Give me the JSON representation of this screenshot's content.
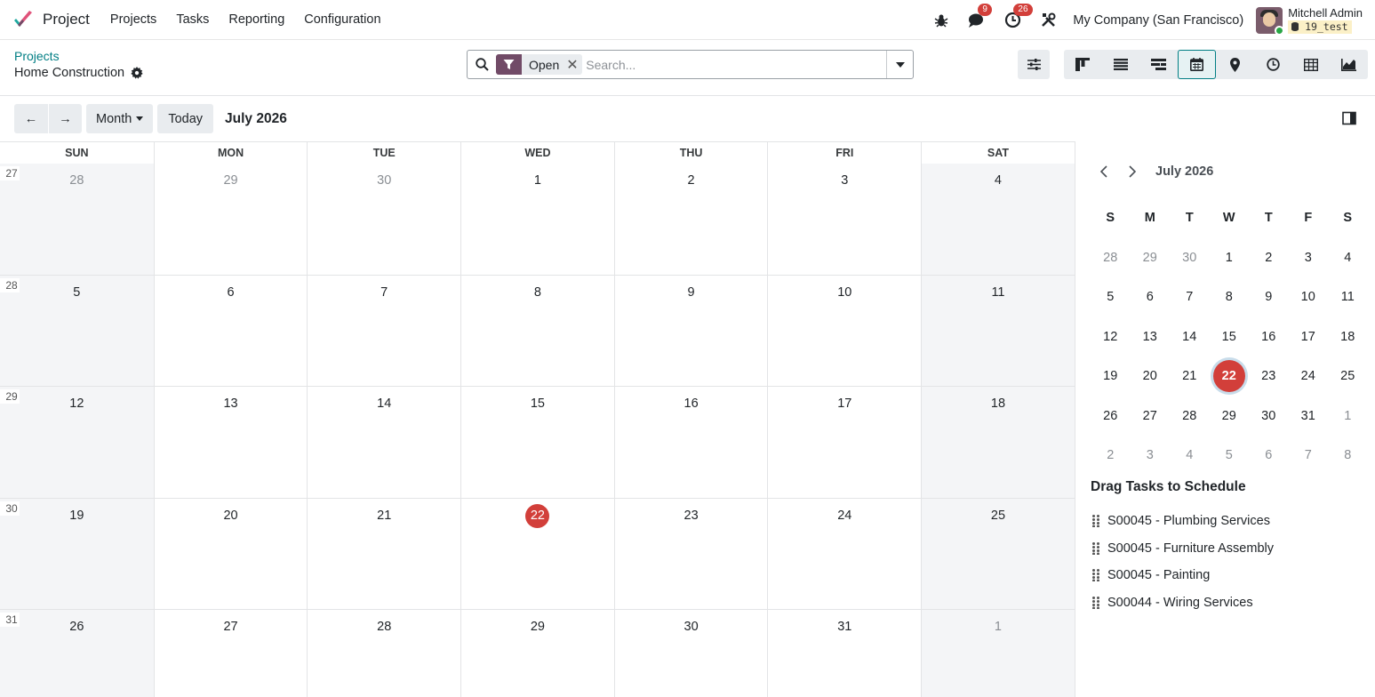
{
  "app": {
    "name": "Project"
  },
  "menu": [
    "Projects",
    "Tasks",
    "Reporting",
    "Configuration"
  ],
  "systray": {
    "messages_count": "9",
    "activities_count": "26",
    "company": "My Company (San Francisco)"
  },
  "user": {
    "name": "Mitchell Admin",
    "database": "19_test"
  },
  "breadcrumb": {
    "parent": "Projects",
    "current": "Home Construction"
  },
  "search": {
    "facet_label": "Open",
    "facet_remove": "✕",
    "placeholder": "Search..."
  },
  "toolbar": {
    "prev": "←",
    "next": "→",
    "scale": "Month",
    "today": "Today",
    "range": "July 2026"
  },
  "weekdays": [
    "SUN",
    "MON",
    "TUE",
    "WED",
    "THU",
    "FRI",
    "SAT"
  ],
  "weeks": [
    {
      "num": "27",
      "days": [
        {
          "d": "28",
          "o": true
        },
        {
          "d": "29",
          "o": true
        },
        {
          "d": "30",
          "o": true
        },
        {
          "d": "1"
        },
        {
          "d": "2"
        },
        {
          "d": "3"
        },
        {
          "d": "4"
        }
      ]
    },
    {
      "num": "28",
      "days": [
        {
          "d": "5"
        },
        {
          "d": "6"
        },
        {
          "d": "7"
        },
        {
          "d": "8"
        },
        {
          "d": "9"
        },
        {
          "d": "10"
        },
        {
          "d": "11"
        }
      ]
    },
    {
      "num": "29",
      "days": [
        {
          "d": "12"
        },
        {
          "d": "13"
        },
        {
          "d": "14"
        },
        {
          "d": "15"
        },
        {
          "d": "16"
        },
        {
          "d": "17"
        },
        {
          "d": "18"
        }
      ]
    },
    {
      "num": "30",
      "days": [
        {
          "d": "19"
        },
        {
          "d": "20"
        },
        {
          "d": "21"
        },
        {
          "d": "22",
          "t": true
        },
        {
          "d": "23"
        },
        {
          "d": "24"
        },
        {
          "d": "25"
        }
      ]
    },
    {
      "num": "31",
      "days": [
        {
          "d": "26"
        },
        {
          "d": "27"
        },
        {
          "d": "28"
        },
        {
          "d": "29"
        },
        {
          "d": "30"
        },
        {
          "d": "31"
        },
        {
          "d": "1",
          "o": true
        }
      ]
    }
  ],
  "mini_calendar": {
    "title": "July 2026",
    "dow": [
      "S",
      "M",
      "T",
      "W",
      "T",
      "F",
      "S"
    ],
    "rows": [
      [
        {
          "d": "28",
          "o": true
        },
        {
          "d": "29",
          "o": true
        },
        {
          "d": "30",
          "o": true
        },
        {
          "d": "1"
        },
        {
          "d": "2"
        },
        {
          "d": "3"
        },
        {
          "d": "4"
        }
      ],
      [
        {
          "d": "5"
        },
        {
          "d": "6"
        },
        {
          "d": "7"
        },
        {
          "d": "8"
        },
        {
          "d": "9"
        },
        {
          "d": "10"
        },
        {
          "d": "11"
        }
      ],
      [
        {
          "d": "12"
        },
        {
          "d": "13"
        },
        {
          "d": "14"
        },
        {
          "d": "15"
        },
        {
          "d": "16"
        },
        {
          "d": "17"
        },
        {
          "d": "18"
        }
      ],
      [
        {
          "d": "19"
        },
        {
          "d": "20"
        },
        {
          "d": "21"
        },
        {
          "d": "22",
          "t": true
        },
        {
          "d": "23"
        },
        {
          "d": "24"
        },
        {
          "d": "25"
        }
      ],
      [
        {
          "d": "26"
        },
        {
          "d": "27"
        },
        {
          "d": "28"
        },
        {
          "d": "29"
        },
        {
          "d": "30"
        },
        {
          "d": "31"
        },
        {
          "d": "1",
          "o": true
        }
      ],
      [
        {
          "d": "2",
          "o": true
        },
        {
          "d": "3",
          "o": true
        },
        {
          "d": "4",
          "o": true
        },
        {
          "d": "5",
          "o": true
        },
        {
          "d": "6",
          "o": true
        },
        {
          "d": "7",
          "o": true
        },
        {
          "d": "8",
          "o": true
        }
      ]
    ]
  },
  "drag": {
    "title": "Drag Tasks to Schedule",
    "items": [
      "S00045 - Plumbing Services",
      "S00045 - Furniture Assembly",
      "S00045 - Painting",
      "S00044 - Wiring Services"
    ]
  },
  "colors": {
    "accent": "#714b67",
    "link": "#017e84",
    "today": "#d23f3a",
    "weekend_bg": "#f4f5f7"
  },
  "icons": {
    "views": [
      "kanban-icon",
      "list-icon",
      "gantt-icon",
      "calendar-icon",
      "map-pin-icon",
      "activity-clock-icon",
      "pivot-icon",
      "graph-icon"
    ]
  }
}
